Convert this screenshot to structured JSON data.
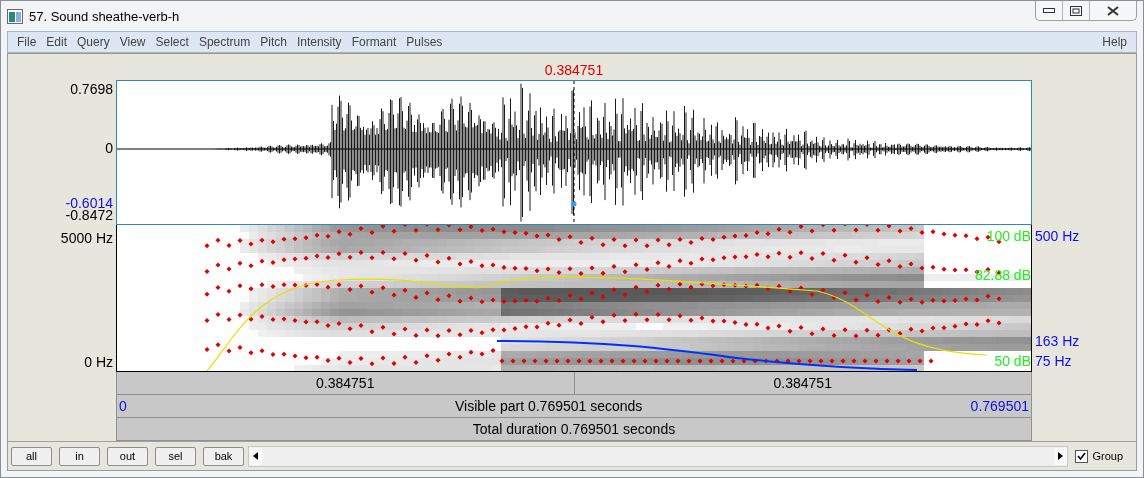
{
  "window": {
    "title": "57. Sound sheathe-verb-h"
  },
  "menu": {
    "left": [
      "File",
      "Edit",
      "Query",
      "View",
      "Select",
      "Spectrum",
      "Pitch",
      "Intensity",
      "Formant",
      "Pulses"
    ],
    "right": [
      "Help"
    ]
  },
  "cursor_time": "0.384751",
  "waveform": {
    "max_label": "0.7698",
    "zero_label": "0",
    "cursor_value": "-0.6014",
    "min_label": "-0.8472"
  },
  "spectrogram": {
    "top_label": "5000 Hz",
    "bottom_label": "0 Hz",
    "intensity_labels": {
      "top": "100 dB",
      "current": "82.88 dB",
      "bottom": "50 dB"
    },
    "pitch_labels": {
      "top": "500 Hz",
      "current": "163 Hz",
      "bottom": "75 Hz"
    }
  },
  "time_bars": {
    "segments": [
      "0.384751",
      "0.384751"
    ],
    "visible_start": "0",
    "visible_label": "Visible part 0.769501 seconds",
    "visible_end": "0.769501",
    "total_label": "Total duration 0.769501 seconds"
  },
  "toolbar": {
    "buttons": [
      "all",
      "in",
      "out",
      "sel",
      "bak"
    ],
    "group": {
      "label": "Group",
      "checked": true
    }
  }
}
